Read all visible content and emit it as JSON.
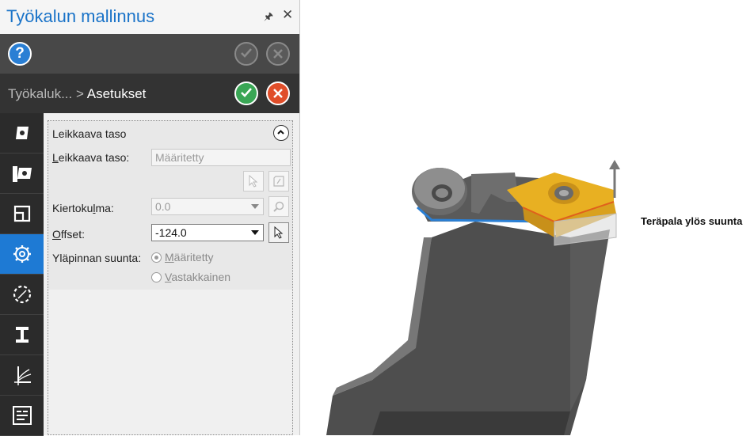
{
  "panel": {
    "title": "Työkalun mallinnus",
    "pin_icon": "pin-icon",
    "close_icon": "close-icon"
  },
  "breadcrumb": {
    "parent": "Työkaluk...",
    "separator": ">",
    "current": "Asetukset"
  },
  "sidebar": {
    "items": [
      {
        "icon": "insert-icon"
      },
      {
        "icon": "holder-insert-icon"
      },
      {
        "icon": "profile-icon"
      },
      {
        "icon": "settings-gear-icon",
        "active": true
      },
      {
        "icon": "dashed-circle-icon"
      },
      {
        "icon": "holder-part-icon"
      },
      {
        "icon": "axes-icon"
      },
      {
        "icon": "table-icon"
      }
    ]
  },
  "section": {
    "title": "Leikkaava taso",
    "cutting_plane": {
      "label_pre": "L",
      "label_rest": "eikkaava taso:",
      "value": "Määritetty"
    },
    "rotation": {
      "label_pre": "Kiertoku",
      "label_u": "l",
      "label_post": "ma:",
      "value": "0.0"
    },
    "offset": {
      "label_pre": "",
      "label_u": "O",
      "label_post": "ffset:",
      "value": "-124.0"
    },
    "top_direction": {
      "label": "Yläpinnan suunta:",
      "options": [
        {
          "u": "M",
          "rest": "ääritetty",
          "selected": true
        },
        {
          "u": "V",
          "rest": "astakkainen",
          "selected": false
        }
      ]
    }
  },
  "viewport": {
    "annotation": "Teräpala ylös suunta"
  },
  "colors": {
    "accent": "#1e7ad4",
    "title": "#1a73c8",
    "ok": "#3aa655",
    "cancel": "#e04e2a",
    "insert": "#e8b022"
  }
}
